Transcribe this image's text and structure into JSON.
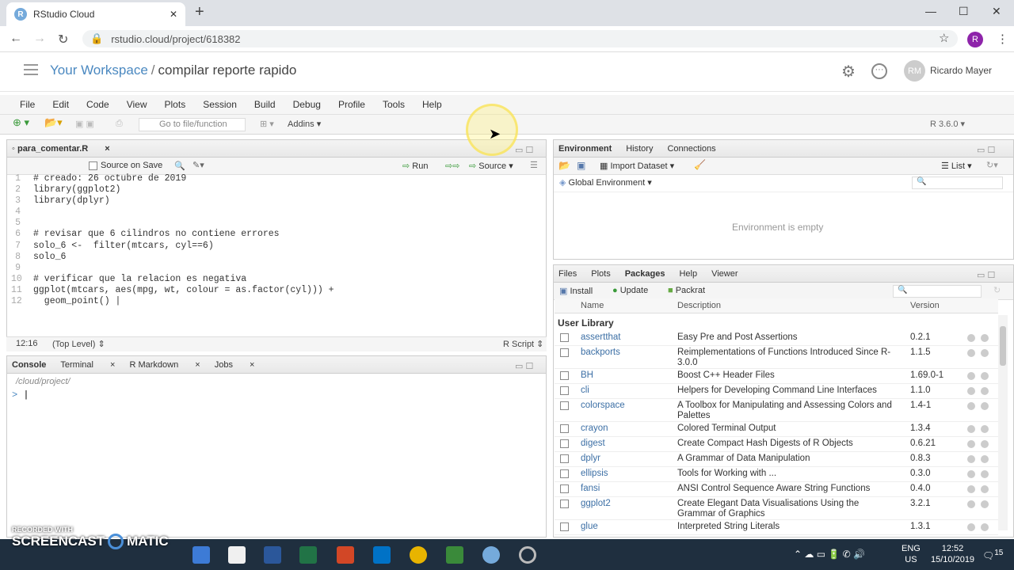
{
  "browser": {
    "tab_title": "RStudio Cloud",
    "url": "rstudio.cloud/project/618382",
    "profile_initial": "R"
  },
  "workspace": {
    "name": "Your Workspace",
    "separator": "/",
    "project": "compilar reporte rapido",
    "user": "Ricardo Mayer",
    "avatar_initials": "RM"
  },
  "menu": [
    "File",
    "Edit",
    "Code",
    "View",
    "Plots",
    "Session",
    "Build",
    "Debug",
    "Profile",
    "Tools",
    "Help"
  ],
  "toolbar": {
    "goto_placeholder": "Go to file/function",
    "addins": "Addins",
    "r_version": "R 3.6.0"
  },
  "editor": {
    "file_tab": "para_comentar.R",
    "source_on_save": "Source on Save",
    "run": "Run",
    "source": "Source",
    "lines": [
      {
        "n": "1",
        "text": "# creado: 26 octubre de 2019",
        "comment": true
      },
      {
        "n": "2",
        "text": "library(ggplot2)",
        "comment": false
      },
      {
        "n": "3",
        "text": "library(dplyr)",
        "comment": false
      },
      {
        "n": "4",
        "text": "",
        "comment": false
      },
      {
        "n": "5",
        "text": "",
        "comment": false
      },
      {
        "n": "6",
        "text": "# revisar que 6 cilindros no contiene errores",
        "comment": true
      },
      {
        "n": "7",
        "text": "solo_6 <-  filter(mtcars, cyl==6)",
        "comment": false
      },
      {
        "n": "8",
        "text": "solo_6",
        "comment": false
      },
      {
        "n": "9",
        "text": "",
        "comment": false
      },
      {
        "n": "10",
        "text": "# verificar que la relacion es negativa",
        "comment": true
      },
      {
        "n": "11",
        "text": "ggplot(mtcars, aes(mpg, wt, colour = as.factor(cyl))) +",
        "comment": false
      },
      {
        "n": "12",
        "text": "  geom_point() |",
        "comment": false
      }
    ],
    "status_pos": "12:16",
    "status_scope": "(Top Level)",
    "status_type": "R Script"
  },
  "console": {
    "tabs": [
      "Console",
      "Terminal",
      "R Markdown",
      "Jobs"
    ],
    "path": "/cloud/project/",
    "prompt": ">"
  },
  "env": {
    "tabs": [
      "Environment",
      "History",
      "Connections"
    ],
    "import": "Import Dataset",
    "list": "List",
    "scope": "Global Environment",
    "empty": "Environment is empty"
  },
  "files": {
    "tabs": [
      "Files",
      "Plots",
      "Packages",
      "Help",
      "Viewer"
    ],
    "install": "Install",
    "update": "Update",
    "packrat": "Packrat",
    "headers": {
      "name": "Name",
      "description": "Description",
      "version": "Version"
    },
    "section": "User Library",
    "packages": [
      {
        "name": "assertthat",
        "desc": "Easy Pre and Post Assertions",
        "ver": "0.2.1"
      },
      {
        "name": "backports",
        "desc": "Reimplementations of Functions Introduced Since R-3.0.0",
        "ver": "1.1.5"
      },
      {
        "name": "BH",
        "desc": "Boost C++ Header Files",
        "ver": "1.69.0-1"
      },
      {
        "name": "cli",
        "desc": "Helpers for Developing Command Line Interfaces",
        "ver": "1.1.0"
      },
      {
        "name": "colorspace",
        "desc": "A Toolbox for Manipulating and Assessing Colors and Palettes",
        "ver": "1.4-1"
      },
      {
        "name": "crayon",
        "desc": "Colored Terminal Output",
        "ver": "1.3.4"
      },
      {
        "name": "digest",
        "desc": "Create Compact Hash Digests of R Objects",
        "ver": "0.6.21"
      },
      {
        "name": "dplyr",
        "desc": "A Grammar of Data Manipulation",
        "ver": "0.8.3"
      },
      {
        "name": "ellipsis",
        "desc": "Tools for Working with ...",
        "ver": "0.3.0"
      },
      {
        "name": "fansi",
        "desc": "ANSI Control Sequence Aware String Functions",
        "ver": "0.4.0"
      },
      {
        "name": "ggplot2",
        "desc": "Create Elegant Data Visualisations Using the Grammar of Graphics",
        "ver": "3.2.1"
      },
      {
        "name": "glue",
        "desc": "Interpreted String Literals",
        "ver": "1.3.1"
      }
    ]
  },
  "taskbar": {
    "lang": "ENG",
    "region": "US",
    "time": "12:52",
    "date": "15/10/2019",
    "notif": "15"
  },
  "watermark": {
    "line1": "RECORDED WITH",
    "line2": "SCREENCAST",
    "line3": "MATIC"
  }
}
